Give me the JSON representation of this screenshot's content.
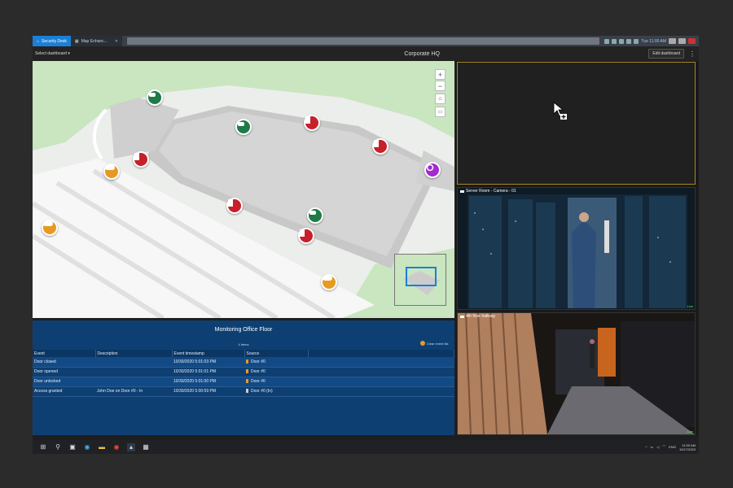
{
  "tabs": [
    {
      "label": "Security Desk"
    },
    {
      "label": "Map Enhanc..."
    }
  ],
  "tray": {
    "time": "Tue 11:00 AM"
  },
  "header": {
    "select_dashboard": "Select dashboard",
    "title": "Corporate HQ",
    "edit_dashboard": "Edit dashboard"
  },
  "map": {
    "controls": {
      "zoom_in": "+",
      "zoom_out": "−"
    }
  },
  "monitor": {
    "title": "Monitoring Office Floor",
    "count": "4 items",
    "clear_label": "Clear event list",
    "columns": [
      "Event",
      "Description",
      "Event timestamp",
      "Source"
    ],
    "rows": [
      {
        "event": "Door closed",
        "description": "",
        "timestamp": "10/30/2020 5:01:03 PM",
        "source": "Door #0"
      },
      {
        "event": "Door opened",
        "description": "",
        "timestamp": "10/30/2020 5:01:01 PM",
        "source": "Door #0"
      },
      {
        "event": "Door unlocked",
        "description": "",
        "timestamp": "10/30/2020 5:01:00 PM",
        "source": "Door #0"
      },
      {
        "event": "Access granted",
        "description": "John Doe on Door #0 - In",
        "timestamp": "10/30/2020 5:00:59 PM",
        "source": "Door #0 (In)"
      }
    ]
  },
  "cameras": [
    {
      "label": "Server Room - Camera - 01",
      "status": "Live"
    },
    {
      "label": "4th floor hallway",
      "status": "Live"
    }
  ],
  "taskbar": {
    "lang": "ENG",
    "time": "11:00 AM",
    "date": "10/17/2023"
  },
  "colors": {
    "accent": "#1b7fd6",
    "panel_blue": "#0e3f73",
    "door_red": "#c7202a",
    "camera_green": "#1e7a46",
    "intercom_orange": "#e79a22",
    "alarm_purple": "#a22ad0",
    "selected_tile": "#a8871f"
  }
}
